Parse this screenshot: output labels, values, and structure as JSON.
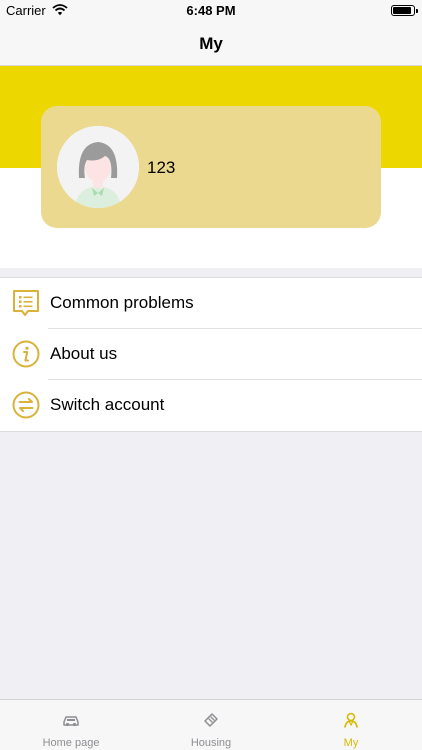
{
  "status_bar": {
    "carrier": "Carrier",
    "time": "6:48 PM"
  },
  "nav": {
    "title": "My"
  },
  "profile": {
    "username": "123"
  },
  "menu": {
    "items": [
      {
        "label": "Common problems",
        "icon": "list-doc-icon"
      },
      {
        "label": "About us",
        "icon": "info-icon"
      },
      {
        "label": "Switch account",
        "icon": "switch-arrows-icon"
      }
    ]
  },
  "tabs": [
    {
      "label": "Home page",
      "icon": "home-car-icon",
      "active": false
    },
    {
      "label": "Housing",
      "icon": "housing-ticket-icon",
      "active": false
    },
    {
      "label": "My",
      "icon": "person-icon",
      "active": true
    }
  ],
  "colors": {
    "accent": "#ecd800",
    "card": "#ebd98f",
    "icon": "#d9b23a",
    "active_tab": "#d9b800"
  }
}
